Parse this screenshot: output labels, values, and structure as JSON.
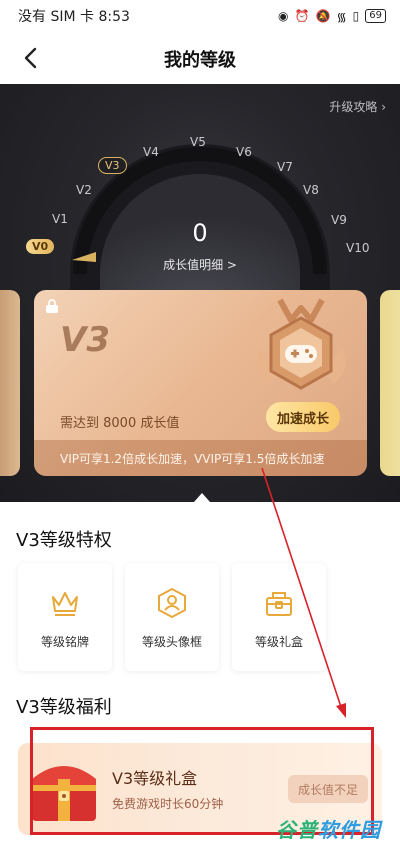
{
  "status_bar": {
    "carrier": "没有 SIM 卡",
    "time": "8:53",
    "battery": "69"
  },
  "nav": {
    "title": "我的等级"
  },
  "hero": {
    "upgrade_link": "升级攻略 ›",
    "levels": [
      "V0",
      "V1",
      "V2",
      "V3",
      "V4",
      "V5",
      "V6",
      "V7",
      "V8",
      "V9",
      "V10"
    ],
    "current_level": "V0",
    "highlight_level": "V3",
    "growth_value": "0",
    "growth_detail_link": "成长值明细 >"
  },
  "card": {
    "level": "V3",
    "requirement": "需达到 8000 成长值",
    "speed_button": "加速成长",
    "footer": "VIP可享1.2倍成长加速，VVIP可享1.5倍成长加速"
  },
  "privileges": {
    "title": "V3等级特权",
    "items": [
      {
        "label": "等级铭牌",
        "icon": "crown-icon"
      },
      {
        "label": "等级头像框",
        "icon": "avatar-frame-icon"
      },
      {
        "label": "等级礼盒",
        "icon": "gift-box-icon"
      }
    ]
  },
  "benefits": {
    "title": "V3等级福利",
    "gift": {
      "title": "V3等级礼盒",
      "subtitle": "免费游戏时长60分钟",
      "button": "成长值不足",
      "icon": "treasure-chest-icon"
    }
  },
  "watermark": {
    "part1": "谷普",
    "part2": "软件园"
  },
  "colors": {
    "accent_gold": "#e9c57a",
    "annotation_red": "#d8222a",
    "card_copper": "#e9b892"
  }
}
